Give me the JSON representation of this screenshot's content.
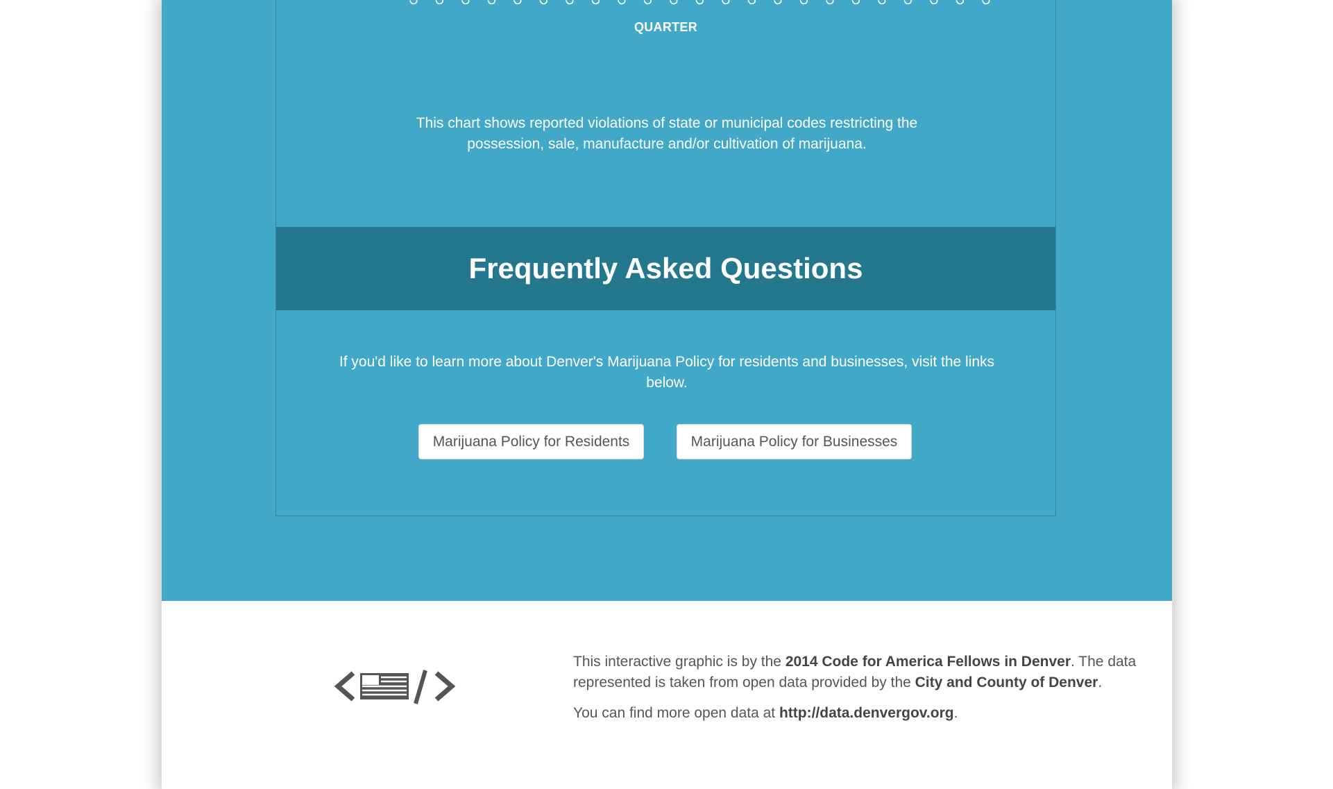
{
  "chart": {
    "axis_title": "QUARTER"
  },
  "chart_description": "This chart shows reported violations of state or municipal codes restricting the possession, sale, manufacture and/or cultivation of marijuana.",
  "faq": {
    "title": "Frequently Asked Questions",
    "text": "If you'd like to learn more about Denver's Marijuana Policy for residents and businesses, visit the links below.",
    "buttons": {
      "residents": "Marijuana Policy for Residents",
      "businesses": "Marijuana Policy for Businesses"
    }
  },
  "footer": {
    "line1_a": "This interactive graphic is by the ",
    "line1_bold": "2014 Code for America Fellows in Denver",
    "line1_b": ". The data represented is taken from open data provided by the ",
    "line1_bold2": "City and County of Denver",
    "line1_c": ".",
    "line2_a": "You can find more open data at ",
    "line2_link": "http://data.denvergov.org",
    "line2_b": "."
  },
  "colors": {
    "background_blue": "#41a8c7",
    "faq_banner": "#24788e",
    "white": "#ffffff",
    "footer_text": "#555555"
  },
  "icons": {
    "logo": "code-for-america-flag-icon"
  }
}
